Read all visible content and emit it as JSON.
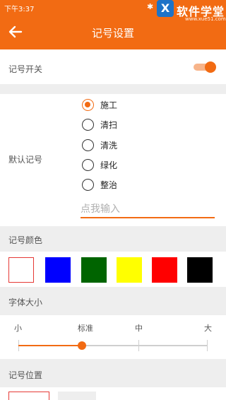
{
  "status_bar": {
    "time": "下午3:37",
    "bluetooth_icon": "bluetooth-icon",
    "watermark": {
      "logo_char": "X",
      "text": "软件学堂",
      "url": "www.xue51.com"
    }
  },
  "header": {
    "title": "记号设置",
    "back_icon": "back-arrow-icon",
    "accent": "#f26b13"
  },
  "mark_switch": {
    "label": "记号开关",
    "enabled": true
  },
  "default_mark": {
    "label": "默认记号",
    "options": [
      "施工",
      "清扫",
      "清洗",
      "绿化",
      "整治"
    ],
    "selected": "施工",
    "input_placeholder": "点我输入",
    "input_value": ""
  },
  "mark_color": {
    "label": "记号颜色",
    "swatches": [
      "#ffffff",
      "#0000ff",
      "#006400",
      "#ffff00",
      "#ff0000",
      "#000000"
    ],
    "selected_index": 0
  },
  "font_size": {
    "label": "字体大小",
    "levels": [
      "小",
      "标准",
      "中",
      "大"
    ],
    "selected": "标准"
  },
  "mark_position": {
    "label": "记号位置"
  }
}
